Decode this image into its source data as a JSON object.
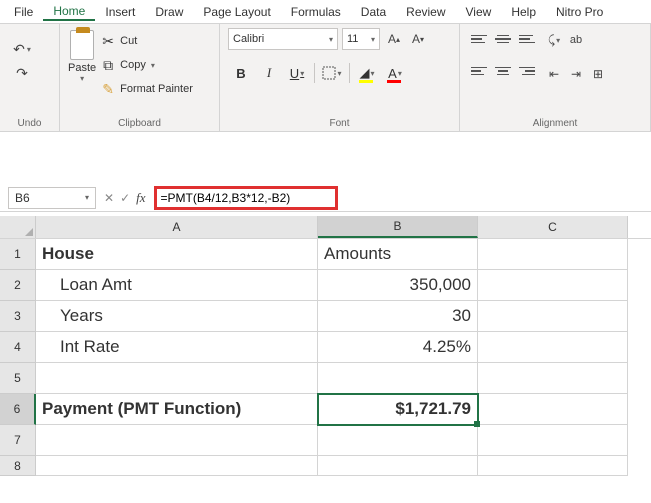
{
  "menu": {
    "file": "File",
    "home": "Home",
    "insert": "Insert",
    "draw": "Draw",
    "page_layout": "Page Layout",
    "formulas": "Formulas",
    "data": "Data",
    "review": "Review",
    "view": "View",
    "help": "Help",
    "nitro": "Nitro Pro"
  },
  "ribbon": {
    "undo_label": "Undo",
    "paste_label": "Paste",
    "cut_label": "Cut",
    "copy_label": "Copy",
    "format_painter_label": "Format Painter",
    "clipboard_label": "Clipboard",
    "font_name": "Calibri",
    "font_size": "11",
    "font_label": "Font",
    "alignment_label": "Alignment",
    "bold": "B",
    "italic": "I",
    "underline": "U",
    "font_color_glyph": "A"
  },
  "formula_bar": {
    "name_box": "B6",
    "formula": "=PMT(B4/12,B3*12,-B2)"
  },
  "columns": {
    "A": "A",
    "B": "B",
    "C": "C"
  },
  "rows": {
    "r1": "1",
    "r2": "2",
    "r3": "3",
    "r4": "4",
    "r5": "5",
    "r6": "6",
    "r7": "7",
    "r8": "8"
  },
  "cells": {
    "A1": "House",
    "B1": "Amounts",
    "A2": "Loan Amt",
    "B2": "350,000",
    "A3": "Years",
    "B3": "30",
    "A4": "Int Rate",
    "B4": "4.25%",
    "A6": "Payment (PMT Function)",
    "B6": "$1,721.79"
  },
  "chart_data": {
    "type": "table",
    "title": "House",
    "rows": [
      {
        "label": "Loan Amt",
        "value": 350000
      },
      {
        "label": "Years",
        "value": 30
      },
      {
        "label": "Int Rate",
        "value": 0.0425
      },
      {
        "label": "Payment (PMT Function)",
        "value": 1721.79
      }
    ],
    "formula": "=PMT(B4/12,B3*12,-B2)"
  }
}
